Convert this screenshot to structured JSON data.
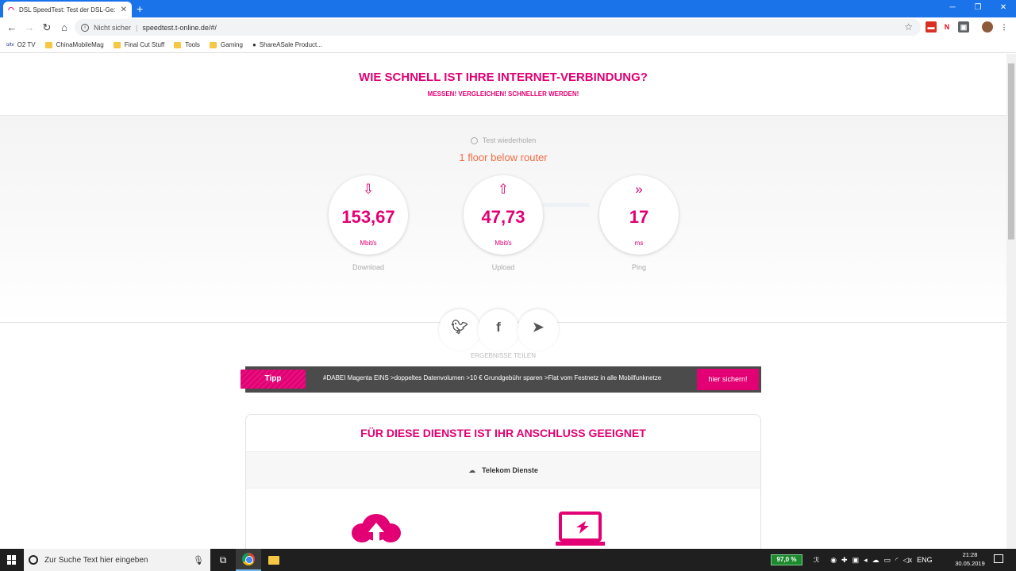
{
  "browser": {
    "tab_title": "DSL SpeedTest: Test der DSL-Ge:",
    "tab_close": "✕",
    "new_tab": "+",
    "security_label": "Nicht sicher",
    "url": "speedtest.t-online.de/#/",
    "bookmarks": [
      "O2 TV",
      "ChinaMobileMag",
      "Final Cut Stuff",
      "Tools",
      "Gaming",
      "ShareASale Product..."
    ]
  },
  "page": {
    "headline": "WIE SCHNELL IST IHRE INTERNET-VERBINDUNG?",
    "subheadline": "MESSEN! VERGLEICHEN! SCHNELLER WERDEN!",
    "retest_label": "Test wiederholen",
    "test_name": "1 floor below router",
    "metrics": [
      {
        "value": "153,67",
        "unit": "Mbit/s",
        "label": "Download",
        "icon": "download-arrow-icon"
      },
      {
        "value": "47,73",
        "unit": "Mbit/s",
        "label": "Upload",
        "icon": "upload-arrow-icon"
      },
      {
        "value": "17",
        "unit": "ms",
        "label": "Ping",
        "icon": "ping-arrow-icon"
      }
    ],
    "share_label": "ERGEBNISSE TEILEN",
    "tip": {
      "tag": "Tipp",
      "text": "#DABEI Magenta EINS >doppeltes Datenvolumen >10 € Grundgebühr sparen >Flat vom Festnetz in alle Mobilfunknetze",
      "button": "hier sichern!"
    },
    "services": {
      "title": "FÜR DIESE DIENSTE IST IHR ANSCHLUSS GEEIGNET",
      "tab": "Telekom Dienste"
    }
  },
  "taskbar": {
    "search_placeholder": "Zur Suche Text hier eingeben",
    "battery": "97,0 %",
    "language": "ENG",
    "time": "21:28",
    "date": "30.05.2019"
  },
  "colors": {
    "brand": "#e20074",
    "accent_orange": "#f26b43",
    "chrome_blue": "#1a73e8"
  }
}
